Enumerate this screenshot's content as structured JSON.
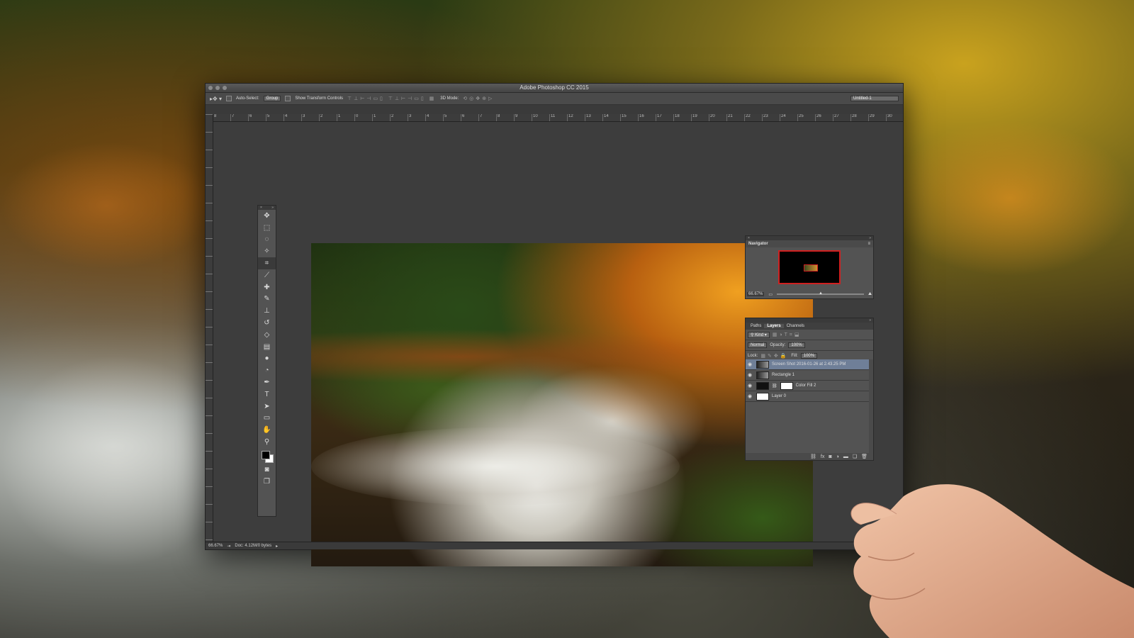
{
  "app": {
    "title": "Adobe Photoshop CC 2015"
  },
  "options_bar": {
    "auto_select_label": "Auto-Select:",
    "auto_select_value": "Group",
    "show_transform_label": "Show Transform Controls",
    "mode_3d_label": "3D Mode:",
    "workspace_value": "Untitled-1"
  },
  "ruler": {
    "top_numbers": [
      "8",
      "7",
      "6",
      "5",
      "4",
      "3",
      "2",
      "1",
      "0",
      "1",
      "2",
      "3",
      "4",
      "5",
      "6",
      "7",
      "8",
      "9",
      "10",
      "11",
      "12",
      "13",
      "14",
      "15",
      "16",
      "17",
      "18",
      "19",
      "20",
      "21",
      "22",
      "23",
      "24",
      "25",
      "26",
      "27",
      "28",
      "29",
      "30"
    ]
  },
  "navigator": {
    "title": "Navigator",
    "zoom": "66.67%"
  },
  "layers_panel": {
    "tabs": [
      {
        "label": "Paths",
        "active": false
      },
      {
        "label": "Layers",
        "active": true
      },
      {
        "label": "Channels",
        "active": false
      }
    ],
    "filter_value": "Kind",
    "blend_mode": "Normal",
    "opacity_label": "Opacity:",
    "opacity_value": "100%",
    "lock_label": "Lock:",
    "fill_label": "Fill:",
    "fill_value": "100%",
    "layers": [
      {
        "name": "Screen Shot 2016-01-26 at 2.43.25 PM",
        "selected": true
      },
      {
        "name": "Rectangle 1",
        "selected": false
      },
      {
        "name": "Color Fill 2",
        "selected": false
      },
      {
        "name": "Layer 0",
        "selected": false
      }
    ]
  },
  "status_bar": {
    "zoom": "66.67%",
    "doc_info": "Doc: 4.12M/0 bytes"
  },
  "colors": {
    "selected_layer": "#6f7f98",
    "panel_bg": "#535353",
    "canvas_bg": "#3d3d3d",
    "navigator_frame": "#d02020"
  }
}
